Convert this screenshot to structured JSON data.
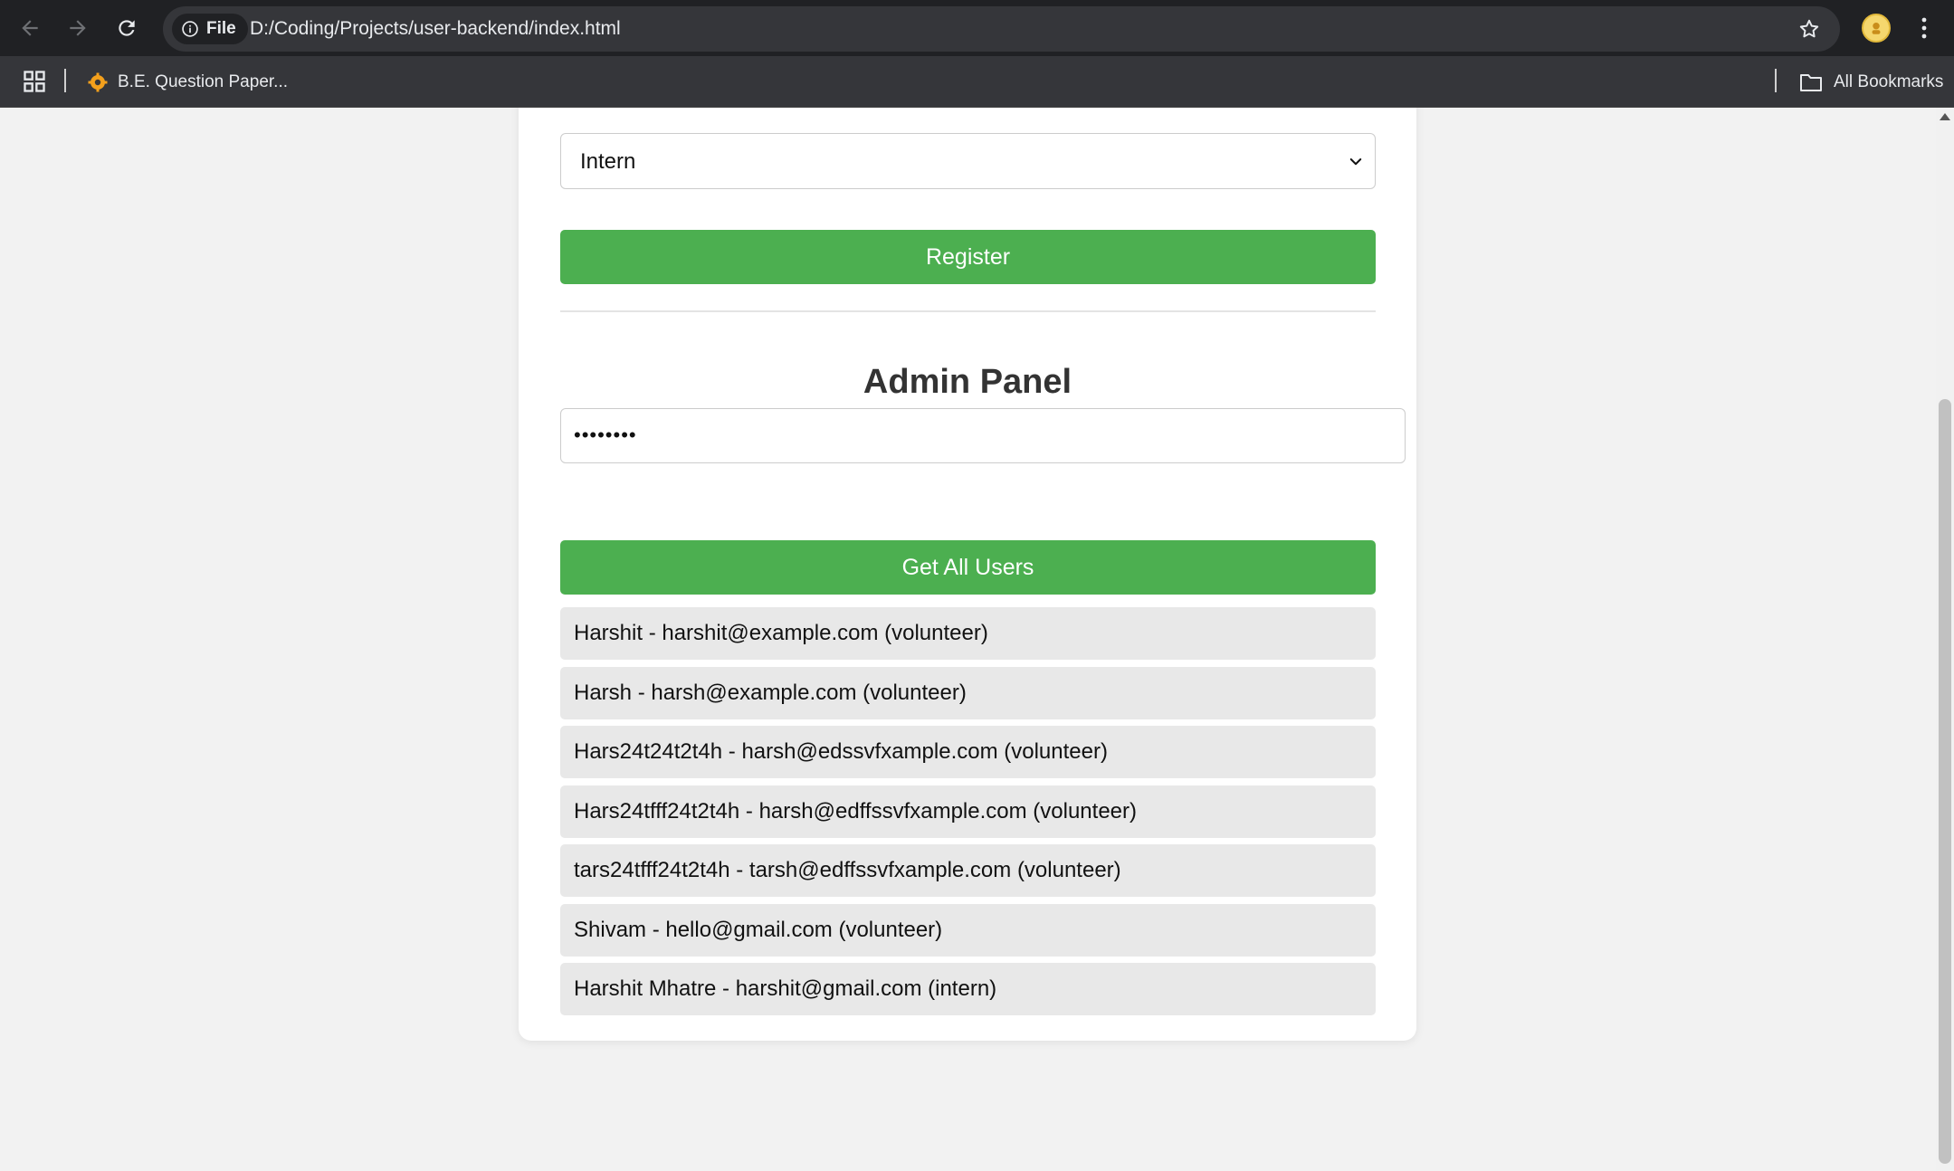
{
  "browser": {
    "url_scheme_label": "File",
    "url": "D:/Coding/Projects/user-backend/index.html",
    "bookmark_label": "B.E. Question Paper...",
    "all_bookmarks_label": "All Bookmarks",
    "icons": [
      "back-icon",
      "forward-icon",
      "reload-icon",
      "info-icon",
      "star-icon",
      "profile-avatar",
      "kebab-menu-icon",
      "apps-grid-icon",
      "folder-icon"
    ]
  },
  "form": {
    "role_selected": "Intern",
    "register_label": "Register"
  },
  "admin": {
    "title": "Admin Panel",
    "password_mask": "••••••••",
    "get_users_label": "Get All Users"
  },
  "users": [
    "Harshit - harshit@example.com (volunteer)",
    "Harsh - harsh@example.com (volunteer)",
    "Hars24t24t2t4h - harsh@edssvfxample.com (volunteer)",
    "Hars24tfff24t2t4h - harsh@edffssvfxample.com (volunteer)",
    "tars24tfff24t2t4h - tarsh@edffssvfxample.com (volunteer)",
    "Shivam - hello@gmail.com (volunteer)",
    "Harshit Mhatre - harshit@gmail.com (intern)"
  ],
  "colors": {
    "accent_green": "#4caf50",
    "chrome_dark": "#202124",
    "page_bg": "#f2f2f2"
  }
}
